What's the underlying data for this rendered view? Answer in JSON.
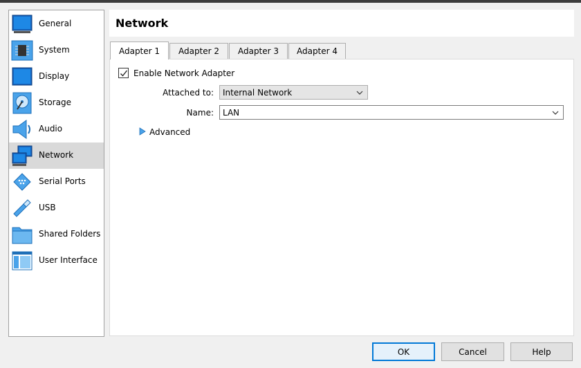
{
  "sidebar": {
    "items": [
      {
        "label": "General",
        "icon": "general-icon"
      },
      {
        "label": "System",
        "icon": "system-icon"
      },
      {
        "label": "Display",
        "icon": "display-icon"
      },
      {
        "label": "Storage",
        "icon": "storage-icon"
      },
      {
        "label": "Audio",
        "icon": "audio-icon"
      },
      {
        "label": "Network",
        "icon": "network-icon",
        "active": true
      },
      {
        "label": "Serial Ports",
        "icon": "serial-port-icon"
      },
      {
        "label": "USB",
        "icon": "usb-icon"
      },
      {
        "label": "Shared Folders",
        "icon": "shared-folder-icon"
      },
      {
        "label": "User Interface",
        "icon": "user-interface-icon"
      }
    ]
  },
  "header": {
    "title": "Network"
  },
  "tabs": [
    {
      "label": "Adapter 1",
      "active": true
    },
    {
      "label": "Adapter 2"
    },
    {
      "label": "Adapter 3"
    },
    {
      "label": "Adapter 4"
    }
  ],
  "adapter": {
    "enable_label": "Enable Network Adapter",
    "enabled": true,
    "attached_label": "Attached to:",
    "attached_value": "Internal Network",
    "name_label": "Name:",
    "name_value": "LAN",
    "advanced_label": "Advanced"
  },
  "buttons": {
    "ok": "OK",
    "cancel": "Cancel",
    "help": "Help"
  },
  "colors": {
    "accent": "#0078d7",
    "icon_blue": "#1e88d8"
  }
}
